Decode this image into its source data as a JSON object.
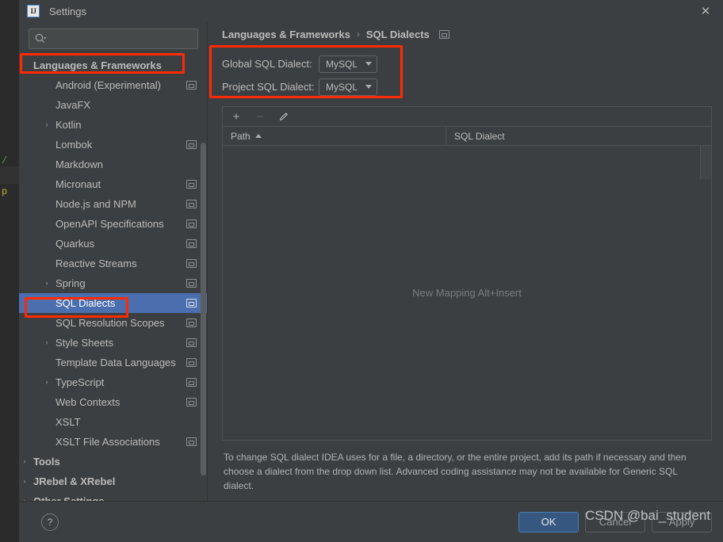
{
  "window": {
    "title": "Settings",
    "app_icon": "intellij-idea-icon",
    "close_icon": "close-icon"
  },
  "ide_backdrop": {
    "fragment_slash": "/",
    "fragment_p": "p"
  },
  "search": {
    "value": "",
    "placeholder": "",
    "icon": "search-icon"
  },
  "sidebar": {
    "items": [
      {
        "label": "Languages & Frameworks",
        "depth": 0,
        "twisty": "",
        "badge": false,
        "selected": false,
        "bold": true
      },
      {
        "label": "Android (Experimental)",
        "depth": 1,
        "twisty": "",
        "badge": true,
        "selected": false,
        "bold": false
      },
      {
        "label": "JavaFX",
        "depth": 1,
        "twisty": "",
        "badge": false,
        "selected": false,
        "bold": false
      },
      {
        "label": "Kotlin",
        "depth": 1,
        "twisty": "›",
        "badge": false,
        "selected": false,
        "bold": false
      },
      {
        "label": "Lombok",
        "depth": 1,
        "twisty": "",
        "badge": true,
        "selected": false,
        "bold": false
      },
      {
        "label": "Markdown",
        "depth": 1,
        "twisty": "",
        "badge": false,
        "selected": false,
        "bold": false
      },
      {
        "label": "Micronaut",
        "depth": 1,
        "twisty": "",
        "badge": true,
        "selected": false,
        "bold": false
      },
      {
        "label": "Node.js and NPM",
        "depth": 1,
        "twisty": "",
        "badge": true,
        "selected": false,
        "bold": false
      },
      {
        "label": "OpenAPI Specifications",
        "depth": 1,
        "twisty": "",
        "badge": true,
        "selected": false,
        "bold": false
      },
      {
        "label": "Quarkus",
        "depth": 1,
        "twisty": "",
        "badge": true,
        "selected": false,
        "bold": false
      },
      {
        "label": "Reactive Streams",
        "depth": 1,
        "twisty": "",
        "badge": true,
        "selected": false,
        "bold": false
      },
      {
        "label": "Spring",
        "depth": 1,
        "twisty": "›",
        "badge": true,
        "selected": false,
        "bold": false
      },
      {
        "label": "SQL Dialects",
        "depth": 1,
        "twisty": "",
        "badge": true,
        "selected": true,
        "bold": false
      },
      {
        "label": "SQL Resolution Scopes",
        "depth": 1,
        "twisty": "",
        "badge": true,
        "selected": false,
        "bold": false
      },
      {
        "label": "Style Sheets",
        "depth": 1,
        "twisty": "›",
        "badge": true,
        "selected": false,
        "bold": false
      },
      {
        "label": "Template Data Languages",
        "depth": 1,
        "twisty": "",
        "badge": true,
        "selected": false,
        "bold": false
      },
      {
        "label": "TypeScript",
        "depth": 1,
        "twisty": "›",
        "badge": true,
        "selected": false,
        "bold": false
      },
      {
        "label": "Web Contexts",
        "depth": 1,
        "twisty": "",
        "badge": true,
        "selected": false,
        "bold": false
      },
      {
        "label": "XSLT",
        "depth": 1,
        "twisty": "",
        "badge": false,
        "selected": false,
        "bold": false
      },
      {
        "label": "XSLT File Associations",
        "depth": 1,
        "twisty": "",
        "badge": true,
        "selected": false,
        "bold": false
      },
      {
        "label": "Tools",
        "depth": 0,
        "twisty": "›",
        "badge": false,
        "selected": false,
        "bold": true
      },
      {
        "label": "JRebel & XRebel",
        "depth": 0,
        "twisty": "›",
        "badge": false,
        "selected": false,
        "bold": true
      },
      {
        "label": "Other Settings",
        "depth": 0,
        "twisty": "›",
        "badge": false,
        "selected": false,
        "bold": true
      }
    ]
  },
  "main": {
    "breadcrumb": {
      "parent": "Languages & Frameworks",
      "separator": "›",
      "current": "SQL Dialects",
      "badge_icon": "project-scope-icon"
    },
    "form": {
      "global_label": "Global SQL Dialect:",
      "global_value": "MySQL",
      "project_label": "Project SQL Dialect:",
      "project_value": "MySQL"
    },
    "toolbar": {
      "add_icon": "plus-icon",
      "add_label": "+",
      "remove_icon": "minus-icon",
      "remove_label": "−",
      "edit_icon": "pencil-icon",
      "edit_label": "✎"
    },
    "table": {
      "columns": [
        "Path",
        "SQL Dialect"
      ],
      "sort_column": "Path",
      "sort_direction": "ascending",
      "rows": [],
      "empty_text": "New Mapping Alt+Insert"
    },
    "hint": "To change SQL dialect IDEA uses for a file, a directory, or the entire project, add its path if necessary and then choose a dialect from the drop down list. Advanced coding assistance may not be available for Generic SQL dialect."
  },
  "footer": {
    "help_icon": "help-icon",
    "help_label": "?",
    "ok_label": "OK",
    "cancel_label": "Cancel",
    "apply_label": "Apply",
    "watermark": "CSDN @bai_student"
  },
  "colors": {
    "dialog_bg": "#3c3f41",
    "selection_blue": "#4b6eaf",
    "primary_button": "#365880",
    "annotation_red": "#ff2a00",
    "text": "#bbbbbb"
  }
}
